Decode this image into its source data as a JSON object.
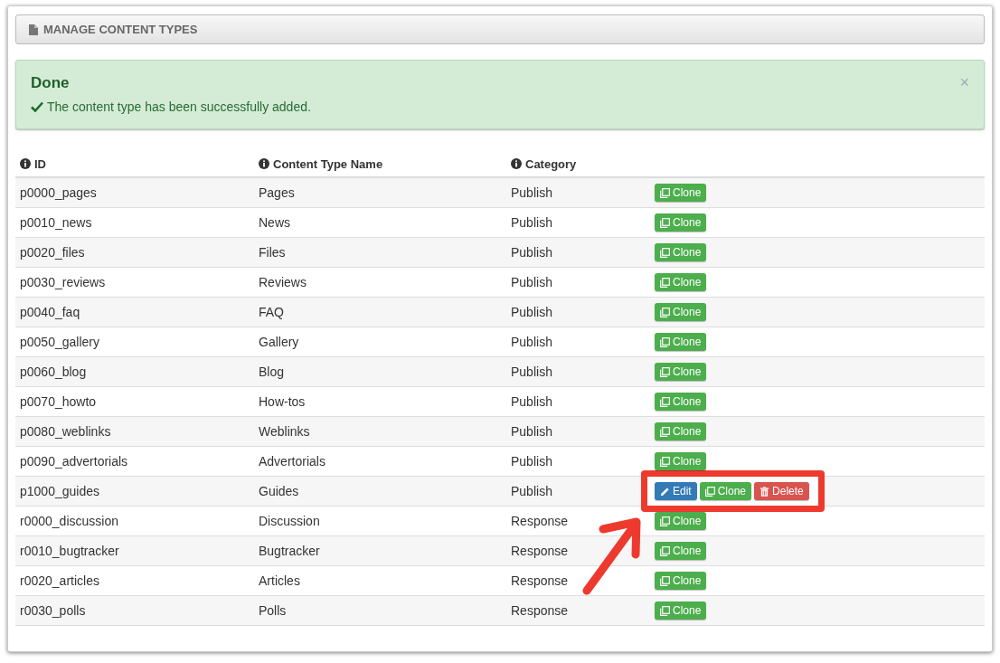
{
  "panel": {
    "title": "MANAGE CONTENT TYPES"
  },
  "alert": {
    "title": "Done",
    "message": "The content type has been successfully added.",
    "close": "×"
  },
  "table": {
    "columns": [
      "ID",
      "Content Type Name",
      "Category"
    ],
    "rows": [
      {
        "id": "p0000_pages",
        "name": "Pages",
        "category": "Publish",
        "highlighted": false,
        "buttons": [
          {
            "kind": "clone",
            "label": "Clone"
          }
        ]
      },
      {
        "id": "p0010_news",
        "name": "News",
        "category": "Publish",
        "highlighted": false,
        "buttons": [
          {
            "kind": "clone",
            "label": "Clone"
          }
        ]
      },
      {
        "id": "p0020_files",
        "name": "Files",
        "category": "Publish",
        "highlighted": false,
        "buttons": [
          {
            "kind": "clone",
            "label": "Clone"
          }
        ]
      },
      {
        "id": "p0030_reviews",
        "name": "Reviews",
        "category": "Publish",
        "highlighted": false,
        "buttons": [
          {
            "kind": "clone",
            "label": "Clone"
          }
        ]
      },
      {
        "id": "p0040_faq",
        "name": "FAQ",
        "category": "Publish",
        "highlighted": false,
        "buttons": [
          {
            "kind": "clone",
            "label": "Clone"
          }
        ]
      },
      {
        "id": "p0050_gallery",
        "name": "Gallery",
        "category": "Publish",
        "highlighted": false,
        "buttons": [
          {
            "kind": "clone",
            "label": "Clone"
          }
        ]
      },
      {
        "id": "p0060_blog",
        "name": "Blog",
        "category": "Publish",
        "highlighted": false,
        "buttons": [
          {
            "kind": "clone",
            "label": "Clone"
          }
        ]
      },
      {
        "id": "p0070_howto",
        "name": "How-tos",
        "category": "Publish",
        "highlighted": false,
        "buttons": [
          {
            "kind": "clone",
            "label": "Clone"
          }
        ]
      },
      {
        "id": "p0080_weblinks",
        "name": "Weblinks",
        "category": "Publish",
        "highlighted": false,
        "buttons": [
          {
            "kind": "clone",
            "label": "Clone"
          }
        ]
      },
      {
        "id": "p0090_advertorials",
        "name": "Advertorials",
        "category": "Publish",
        "highlighted": false,
        "buttons": [
          {
            "kind": "clone",
            "label": "Clone"
          }
        ]
      },
      {
        "id": "p1000_guides",
        "name": "Guides",
        "category": "Publish",
        "highlighted": true,
        "buttons": [
          {
            "kind": "edit",
            "label": "Edit"
          },
          {
            "kind": "clone",
            "label": "Clone"
          },
          {
            "kind": "delete",
            "label": "Delete"
          }
        ]
      },
      {
        "id": "r0000_discussion",
        "name": "Discussion",
        "category": "Response",
        "highlighted": false,
        "buttons": [
          {
            "kind": "clone",
            "label": "Clone"
          }
        ]
      },
      {
        "id": "r0010_bugtracker",
        "name": "Bugtracker",
        "category": "Response",
        "highlighted": false,
        "buttons": [
          {
            "kind": "clone",
            "label": "Clone"
          }
        ]
      },
      {
        "id": "r0020_articles",
        "name": "Articles",
        "category": "Response",
        "highlighted": false,
        "buttons": [
          {
            "kind": "clone",
            "label": "Clone"
          }
        ]
      },
      {
        "id": "r0030_polls",
        "name": "Polls",
        "category": "Response",
        "highlighted": false,
        "buttons": [
          {
            "kind": "clone",
            "label": "Clone"
          }
        ]
      }
    ]
  }
}
